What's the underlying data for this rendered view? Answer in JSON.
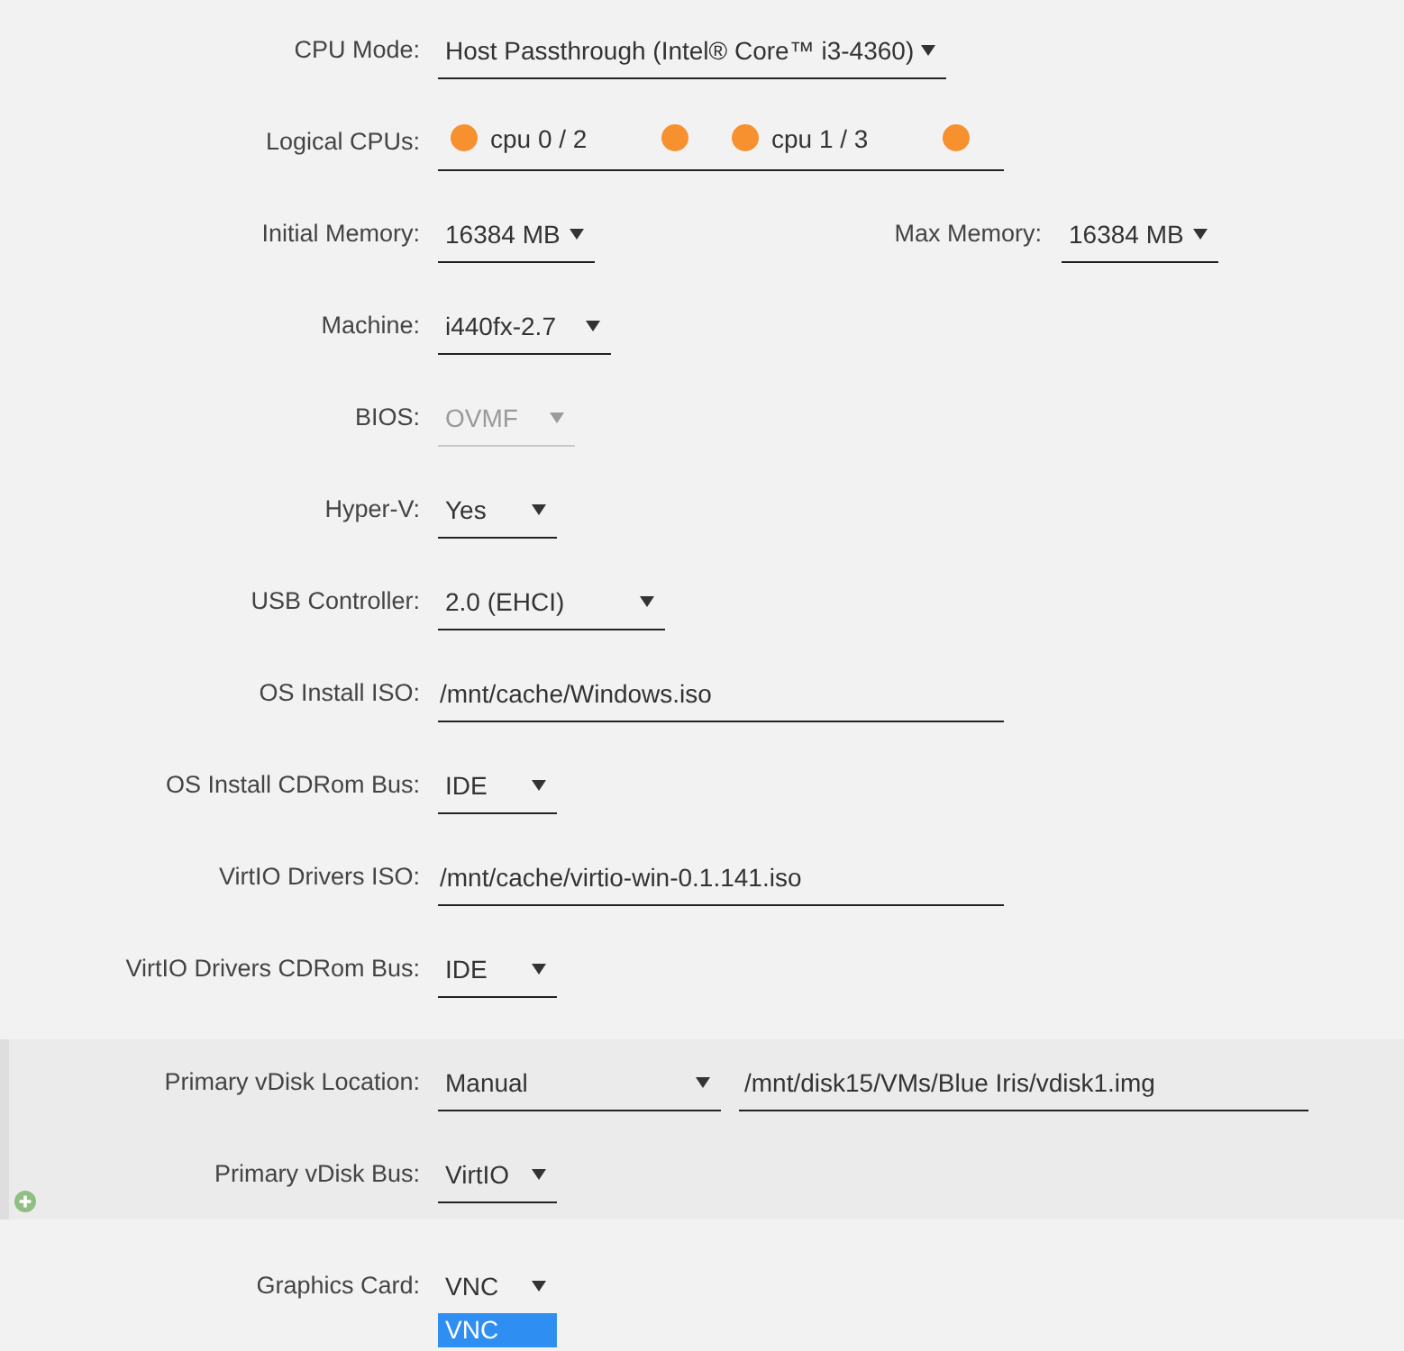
{
  "rows": [
    {
      "kind": "select",
      "label": "CPU Mode:",
      "value": "Host Passthrough (Intel® Core™ i3-4360)",
      "disabled": false
    },
    {
      "kind": "cpus",
      "label": "Logical CPUs:",
      "disabled": false,
      "cpus": [
        {
          "label": "cpu 0 / 2",
          "checkboxes": [
            {
              "checked": true
            },
            {
              "checked": true
            }
          ]
        },
        {
          "label": "cpu 1 / 3",
          "checkboxes": [
            {
              "checked": true
            },
            {
              "checked": true
            }
          ]
        }
      ]
    },
    {
      "kind": "memory",
      "label": "Initial Memory:",
      "value": "16384 MB",
      "max_label": "Max Memory:",
      "max_value": "16384 MB",
      "disabled": false
    },
    {
      "kind": "select",
      "label": "Machine:",
      "value": "i440fx-2.7",
      "disabled": false
    },
    {
      "kind": "select",
      "label": "BIOS:",
      "value": "OVMF",
      "disabled": true
    },
    {
      "kind": "select",
      "label": "Hyper-V:",
      "value": "Yes",
      "disabled": false
    },
    {
      "kind": "select",
      "label": "USB Controller:",
      "value": "2.0 (EHCI)",
      "disabled": false
    },
    {
      "kind": "text",
      "label": "OS Install ISO:",
      "value": "/mnt/cache/Windows.iso",
      "disabled": false
    },
    {
      "kind": "select",
      "label": "OS Install CDRom Bus:",
      "value": "IDE",
      "disabled": false
    },
    {
      "kind": "text",
      "label": "VirtIO Drivers ISO:",
      "value": "/mnt/cache/virtio-win-0.1.141.iso",
      "disabled": false
    },
    {
      "kind": "select",
      "label": "VirtIO Drivers CDRom Bus:",
      "value": "IDE",
      "disabled": false
    }
  ],
  "vdisk": {
    "rows": [
      {
        "kind": "select_path",
        "label": "Primary vDisk Location:",
        "value": "Manual",
        "path": "/mnt/disk15/VMs/Blue Iris/vdisk1.img",
        "disabled": false
      },
      {
        "kind": "select",
        "label": "Primary vDisk Bus:",
        "value": "VirtIO",
        "disabled": false
      }
    ]
  },
  "graphics": {
    "label": "Graphics Card:",
    "value": "VNC",
    "disabled": false,
    "options": [
      {
        "label": "VNC",
        "selected": true
      }
    ]
  }
}
